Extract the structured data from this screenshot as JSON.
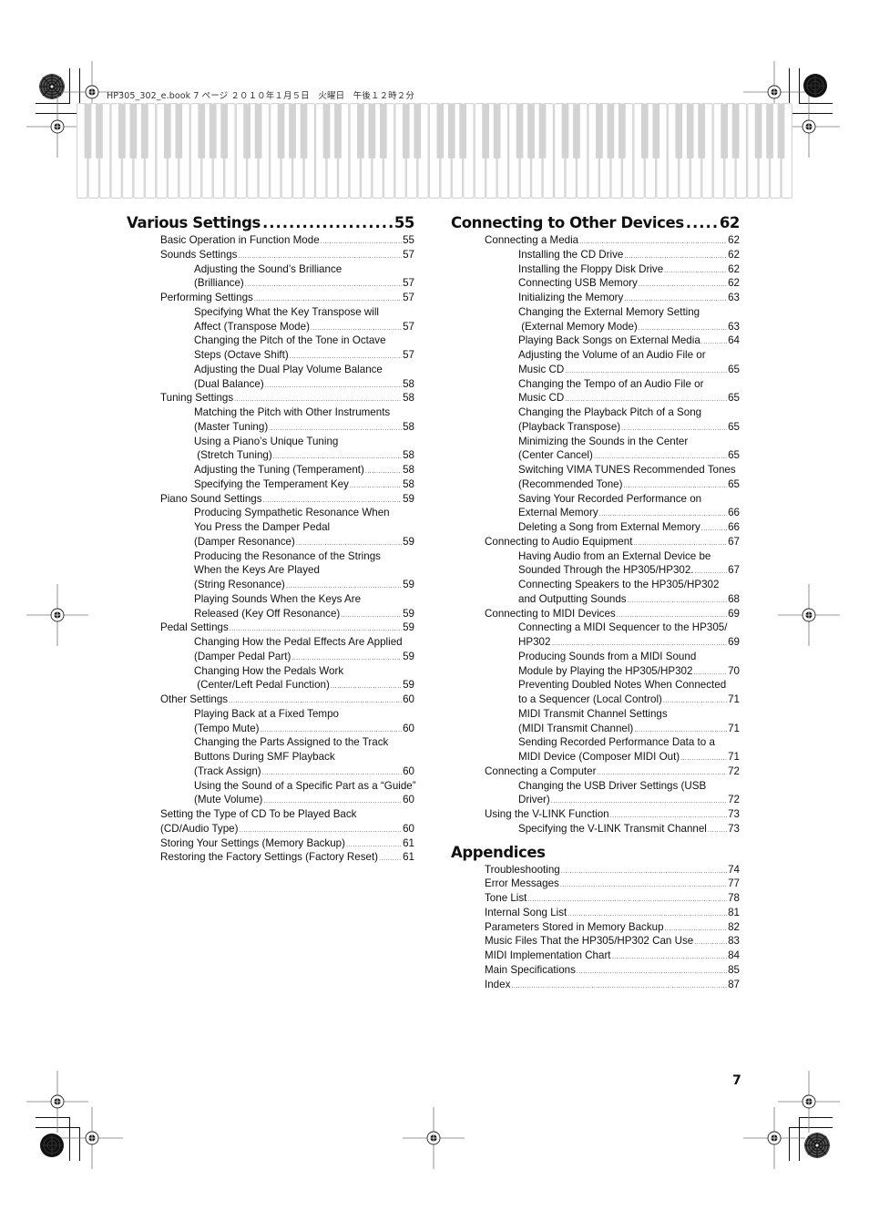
{
  "header": {
    "slug": "HP305_302_e.book  7 ページ  ２０１０年１月５日　火曜日　午後１２時２分"
  },
  "keyboard": {
    "octaves": 9,
    "colors": {
      "white_key_fill": "#ffffff",
      "white_key_stroke": "#d6d6d6",
      "black_key_fill": "#d3d3d3"
    }
  },
  "toc": {
    "left": {
      "sections": [
        {
          "title": "Various Settings",
          "page": "55",
          "entries": [
            {
              "level": 1,
              "lines": [
                "Basic Operation in Function Mode"
              ],
              "page": "55"
            },
            {
              "level": 1,
              "lines": [
                "Sounds Settings"
              ],
              "page": "57"
            },
            {
              "level": 2,
              "lines": [
                "Adjusting the Sound’s Brilliance",
                "(Brilliance)"
              ],
              "page": "57"
            },
            {
              "level": 1,
              "lines": [
                "Performing Settings"
              ],
              "page": "57"
            },
            {
              "level": 2,
              "lines": [
                "Specifying What the Key Transpose will",
                "Affect (Transpose Mode)"
              ],
              "page": "57"
            },
            {
              "level": 2,
              "lines": [
                "Changing the Pitch of the Tone in Octave",
                "Steps (Octave Shift)"
              ],
              "page": "57"
            },
            {
              "level": 2,
              "lines": [
                "Adjusting the Dual Play Volume Balance",
                "(Dual Balance)"
              ],
              "page": "58"
            },
            {
              "level": 1,
              "lines": [
                "Tuning Settings"
              ],
              "page": "58"
            },
            {
              "level": 2,
              "lines": [
                "Matching the Pitch with Other Instruments",
                "(Master Tuning)"
              ],
              "page": "58"
            },
            {
              "level": 2,
              "lines": [
                "Using a Piano’s Unique Tuning",
                " (Stretch Tuning)"
              ],
              "page": "58"
            },
            {
              "level": 2,
              "lines": [
                "Adjusting the Tuning (Temperament)"
              ],
              "page": "58"
            },
            {
              "level": 2,
              "lines": [
                "Specifying the Temperament Key"
              ],
              "page": "58"
            },
            {
              "level": 1,
              "lines": [
                "Piano Sound Settings"
              ],
              "page": "59"
            },
            {
              "level": 2,
              "lines": [
                "Producing Sympathetic Resonance When",
                "You Press the Damper Pedal",
                "(Damper Resonance)"
              ],
              "page": "59"
            },
            {
              "level": 2,
              "lines": [
                "Producing the Resonance of the Strings",
                "When the Keys Are Played",
                "(String Resonance)"
              ],
              "page": "59"
            },
            {
              "level": 2,
              "lines": [
                "Playing Sounds When the Keys Are",
                "Released (Key Off Resonance)"
              ],
              "page": "59"
            },
            {
              "level": 1,
              "lines": [
                "Pedal Settings"
              ],
              "page": "59"
            },
            {
              "level": 2,
              "lines": [
                "Changing How the Pedal Effects Are Applied",
                "(Damper Pedal Part)"
              ],
              "page": "59"
            },
            {
              "level": 2,
              "lines": [
                "Changing How the Pedals Work",
                " (Center/Left Pedal Function)"
              ],
              "page": "59"
            },
            {
              "level": 1,
              "lines": [
                "Other Settings"
              ],
              "page": "60"
            },
            {
              "level": 2,
              "lines": [
                "Playing Back at a Fixed Tempo",
                "(Tempo Mute)"
              ],
              "page": "60"
            },
            {
              "level": 2,
              "lines": [
                "Changing the Parts Assigned to the Track",
                "Buttons During SMF Playback",
                "(Track Assign)"
              ],
              "page": "60"
            },
            {
              "level": 2,
              "lines": [
                "Using the Sound of a Specific Part as a “Guide”",
                "(Mute Volume)"
              ],
              "page": "60"
            },
            {
              "level": 1,
              "lines": [
                "Setting the Type of CD To be Played Back",
                "(CD/Audio Type)"
              ],
              "page": "60"
            },
            {
              "level": 1,
              "lines": [
                "Storing Your Settings (Memory Backup)"
              ],
              "page": "61"
            },
            {
              "level": 1,
              "lines": [
                "Restoring the Factory Settings (Factory Reset)"
              ],
              "page": "61"
            }
          ]
        }
      ]
    },
    "right": {
      "sections": [
        {
          "title": "Connecting to Other Devices",
          "page": "62",
          "entries": [
            {
              "level": 1,
              "lines": [
                "Connecting a Media"
              ],
              "page": "62"
            },
            {
              "level": 2,
              "lines": [
                "Installing the CD Drive"
              ],
              "page": "62"
            },
            {
              "level": 2,
              "lines": [
                "Installing the Floppy Disk Drive"
              ],
              "page": "62"
            },
            {
              "level": 2,
              "lines": [
                "Connecting USB Memory"
              ],
              "page": "62"
            },
            {
              "level": 2,
              "lines": [
                "Initializing the Memory"
              ],
              "page": "63"
            },
            {
              "level": 2,
              "lines": [
                "Changing the External Memory Setting",
                " (External Memory Mode)"
              ],
              "page": "63"
            },
            {
              "level": 2,
              "lines": [
                "Playing Back Songs on External Media"
              ],
              "page": "64"
            },
            {
              "level": 2,
              "lines": [
                "Adjusting the Volume of an Audio File or",
                "Music CD"
              ],
              "page": "65"
            },
            {
              "level": 2,
              "lines": [
                "Changing the Tempo of an Audio File or",
                "Music CD"
              ],
              "page": "65"
            },
            {
              "level": 2,
              "lines": [
                "Changing the Playback Pitch of a Song",
                "(Playback Transpose)"
              ],
              "page": "65"
            },
            {
              "level": 2,
              "lines": [
                "Minimizing the Sounds in the Center",
                "(Center Cancel)"
              ],
              "page": "65"
            },
            {
              "level": 2,
              "lines": [
                "Switching VIMA TUNES Recommended Tones",
                "(Recommended Tone)"
              ],
              "page": "65"
            },
            {
              "level": 2,
              "lines": [
                "Saving Your Recorded Performance on",
                "External Memory"
              ],
              "page": "66"
            },
            {
              "level": 2,
              "lines": [
                "Deleting a Song from External Memory"
              ],
              "page": "66"
            },
            {
              "level": 1,
              "lines": [
                "Connecting to Audio Equipment"
              ],
              "page": "67"
            },
            {
              "level": 2,
              "lines": [
                "Having Audio from an External Device be",
                "Sounded Through the HP305/HP302."
              ],
              "page": "67"
            },
            {
              "level": 2,
              "lines": [
                "Connecting Speakers to the HP305/HP302",
                "and Outputting Sounds"
              ],
              "page": "68"
            },
            {
              "level": 1,
              "lines": [
                "Connecting to MIDI Devices"
              ],
              "page": "69"
            },
            {
              "level": 2,
              "lines": [
                "Connecting a MIDI Sequencer to the HP305/",
                "HP302"
              ],
              "page": "69"
            },
            {
              "level": 2,
              "lines": [
                "Producing Sounds from a MIDI Sound",
                "Module by Playing the HP305/HP302"
              ],
              "page": "70"
            },
            {
              "level": 2,
              "lines": [
                "Preventing Doubled Notes When Connected",
                "to a Sequencer (Local Control)"
              ],
              "page": "71"
            },
            {
              "level": 2,
              "lines": [
                "MIDI Transmit Channel Settings",
                "(MIDI Transmit Channel)"
              ],
              "page": "71"
            },
            {
              "level": 2,
              "lines": [
                "Sending Recorded Performance Data to a",
                "MIDI Device (Composer MIDI Out)"
              ],
              "page": "71"
            },
            {
              "level": 1,
              "lines": [
                "Connecting a Computer"
              ],
              "page": "72"
            },
            {
              "level": 2,
              "lines": [
                "Changing the USB Driver Settings (USB",
                "Driver)"
              ],
              "page": "72"
            },
            {
              "level": 1,
              "lines": [
                "Using the V-LINK Function"
              ],
              "page": "73"
            },
            {
              "level": 2,
              "lines": [
                "Specifying the V-LINK Transmit Channel"
              ],
              "page": "73"
            }
          ]
        },
        {
          "title": "Appendices",
          "page": "",
          "entries": [
            {
              "level": 1,
              "lines": [
                "Troubleshooting"
              ],
              "page": "74"
            },
            {
              "level": 1,
              "lines": [
                "Error Messages"
              ],
              "page": "77"
            },
            {
              "level": 1,
              "lines": [
                "Tone List"
              ],
              "page": "78"
            },
            {
              "level": 1,
              "lines": [
                "Internal Song List"
              ],
              "page": "81"
            },
            {
              "level": 1,
              "lines": [
                "Parameters Stored in Memory Backup"
              ],
              "page": "82"
            },
            {
              "level": 1,
              "lines": [
                "Music Files That the HP305/HP302 Can Use"
              ],
              "page": "83"
            },
            {
              "level": 1,
              "lines": [
                "MIDI Implementation Chart"
              ],
              "page": "84"
            },
            {
              "level": 1,
              "lines": [
                "Main Specifications"
              ],
              "page": "85"
            },
            {
              "level": 1,
              "lines": [
                "Index"
              ],
              "page": "87"
            }
          ]
        }
      ]
    }
  },
  "footer": {
    "page_number": "7"
  }
}
